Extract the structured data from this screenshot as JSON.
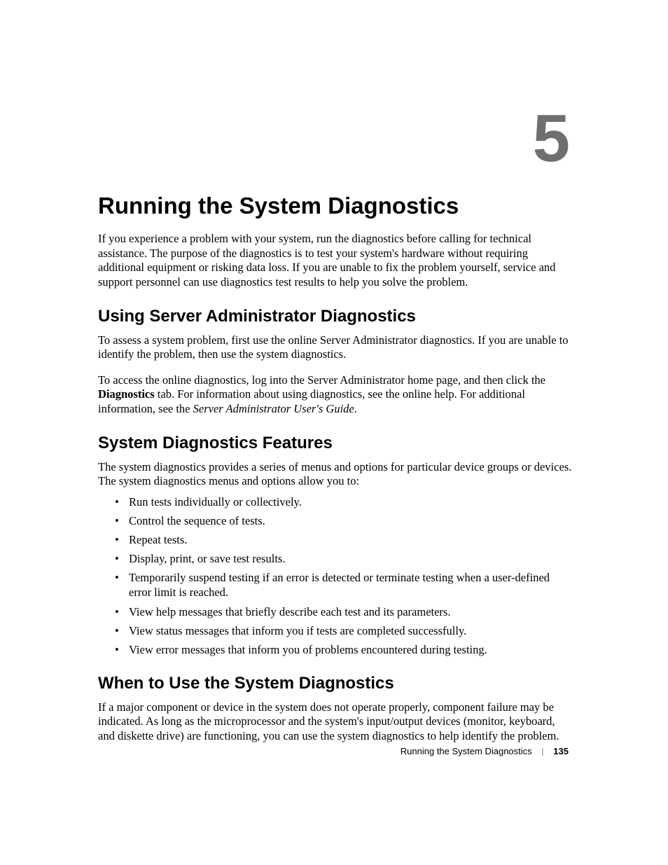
{
  "chapter": {
    "number": "5",
    "title": "Running the System Diagnostics"
  },
  "intro": "If you experience a problem with your system, run the diagnostics before calling for technical assistance. The purpose of the diagnostics is to test your system's hardware without requiring additional equipment or risking data loss. If you are unable to fix the problem yourself, service and support personnel can use diagnostics test results to help you solve the problem.",
  "sections": {
    "using": {
      "heading": "Using Server Administrator Diagnostics",
      "p1": "To assess a system problem, first use the online Server Administrator diagnostics. If you are unable to identify the problem, then use the system diagnostics.",
      "p2_a": "To access the online diagnostics, log into the Server Administrator home page, and then click the ",
      "p2_bold": "Diagnostics",
      "p2_b": " tab. For information about using diagnostics, see the online help. For additional information, see the ",
      "p2_italic": "Server Administrator User's Guide",
      "p2_c": "."
    },
    "features": {
      "heading": "System Diagnostics Features",
      "intro": "The system diagnostics provides a series of menus and options for particular device groups or devices. The system diagnostics menus and options allow you to:",
      "items": [
        "Run tests individually or collectively.",
        "Control the sequence of tests.",
        "Repeat tests.",
        "Display, print, or save test results.",
        "Temporarily suspend testing if an error is detected or terminate testing when a user-defined error limit is reached.",
        "View help messages that briefly describe each test and its parameters.",
        "View status messages that inform you if tests are completed successfully.",
        "View error messages that inform you of problems encountered during testing."
      ]
    },
    "when": {
      "heading": "When to Use the System Diagnostics",
      "p1": "If a major component or device in the system does not operate properly, component failure may be indicated. As long as the microprocessor and the system's input/output devices (monitor, keyboard, and diskette drive) are functioning, you can use the system diagnostics to help identify the problem."
    }
  },
  "footer": {
    "title": "Running the System Diagnostics",
    "page": "135"
  }
}
